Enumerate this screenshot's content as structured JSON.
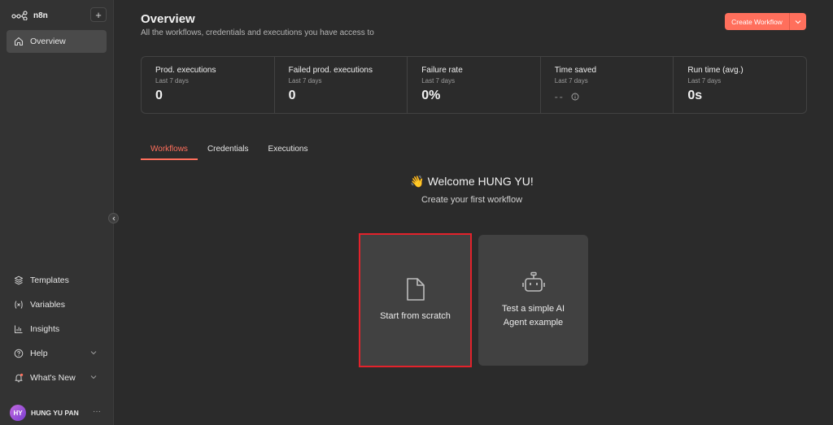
{
  "sidebar": {
    "brand": "n8n",
    "overview_label": "Overview",
    "bottom_items": [
      {
        "label": "Templates",
        "icon": "box-icon"
      },
      {
        "label": "Variables",
        "icon": "variable-icon"
      },
      {
        "label": "Insights",
        "icon": "chart-icon"
      },
      {
        "label": "Help",
        "icon": "help-icon"
      },
      {
        "label": "What's New",
        "icon": "bell-icon"
      }
    ],
    "user": {
      "initials": "HY",
      "name": "HUNG YU PAN",
      "menu": "···"
    }
  },
  "header": {
    "title": "Overview",
    "subtitle": "All the workflows, credentials and executions you have access to",
    "create_label": "Create Workflow"
  },
  "stats": [
    {
      "title": "Prod. executions",
      "period": "Last 7 days",
      "value": "0"
    },
    {
      "title": "Failed prod. executions",
      "period": "Last 7 days",
      "value": "0"
    },
    {
      "title": "Failure rate",
      "period": "Last 7 days",
      "value": "0%"
    },
    {
      "title": "Time saved",
      "period": "Last 7 days",
      "value": "--"
    },
    {
      "title": "Run time (avg.)",
      "period": "Last 7 days",
      "value": "0s"
    }
  ],
  "tabs": [
    "Workflows",
    "Credentials",
    "Executions"
  ],
  "welcome": {
    "emoji": "👋",
    "title": "Welcome HUNG YU!",
    "subtitle": "Create your first workflow"
  },
  "cards": {
    "scratch": "Start from scratch",
    "ai": "Test a simple AI Agent example"
  },
  "colors": {
    "accent": "#ff6f5c",
    "highlight": "#e3222b",
    "background": "#2b2b2b",
    "sidebar": "#333333"
  }
}
